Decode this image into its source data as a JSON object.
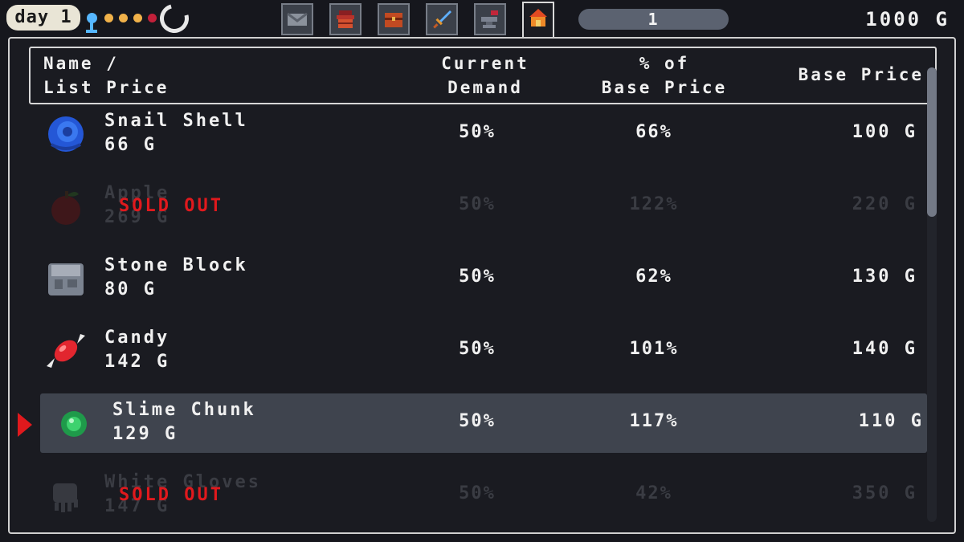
{
  "top_bar": {
    "day_label": "day 1",
    "time_dot_colors": [
      "#f1b24a",
      "#f1b24a",
      "#f1b24a",
      "#c2203a"
    ],
    "clock_icon": "clock-icon",
    "tabs": [
      {
        "icon": "mail-icon",
        "active": false
      },
      {
        "icon": "red-crate-icon",
        "active": false
      },
      {
        "icon": "chest-icon",
        "active": false
      },
      {
        "icon": "sword-icon",
        "active": false
      },
      {
        "icon": "anvil-icon",
        "active": false
      },
      {
        "icon": "shop-icon",
        "active": true
      }
    ],
    "quantity": "1",
    "gold": "1000 G"
  },
  "table": {
    "headers": {
      "name": "Name /\nList Price",
      "demand": "Current\nDemand",
      "percent": "% of\nBase Price",
      "base": "Base Price"
    },
    "rows": [
      {
        "icon": "snail-shell-icon",
        "name": "Snail Shell",
        "list_price": "66 G",
        "demand": "50%",
        "percent": "66%",
        "base": "100 G",
        "sold_out": false,
        "selected": false
      },
      {
        "icon": "apple-icon",
        "name": "Apple",
        "list_price": "269 G",
        "demand": "50%",
        "percent": "122%",
        "base": "220 G",
        "sold_out": true,
        "selected": false
      },
      {
        "icon": "stone-block-icon",
        "name": "Stone Block",
        "list_price": "80 G",
        "demand": "50%",
        "percent": "62%",
        "base": "130 G",
        "sold_out": false,
        "selected": false
      },
      {
        "icon": "candy-icon",
        "name": "Candy",
        "list_price": "142 G",
        "demand": "50%",
        "percent": "101%",
        "base": "140 G",
        "sold_out": false,
        "selected": false
      },
      {
        "icon": "slime-chunk-icon",
        "name": "Slime Chunk",
        "list_price": "129 G",
        "demand": "50%",
        "percent": "117%",
        "base": "110 G",
        "sold_out": false,
        "selected": true
      },
      {
        "icon": "white-gloves-icon",
        "name": "White Gloves",
        "list_price": "147 G",
        "demand": "50%",
        "percent": "42%",
        "base": "350 G",
        "sold_out": true,
        "selected": false
      }
    ],
    "sold_out_label": "SOLD OUT"
  },
  "colors": {
    "background": "#16171d",
    "selected_row": "#3f444e",
    "sold_out_red": "#e0191d",
    "text": "#f0f0f0"
  }
}
